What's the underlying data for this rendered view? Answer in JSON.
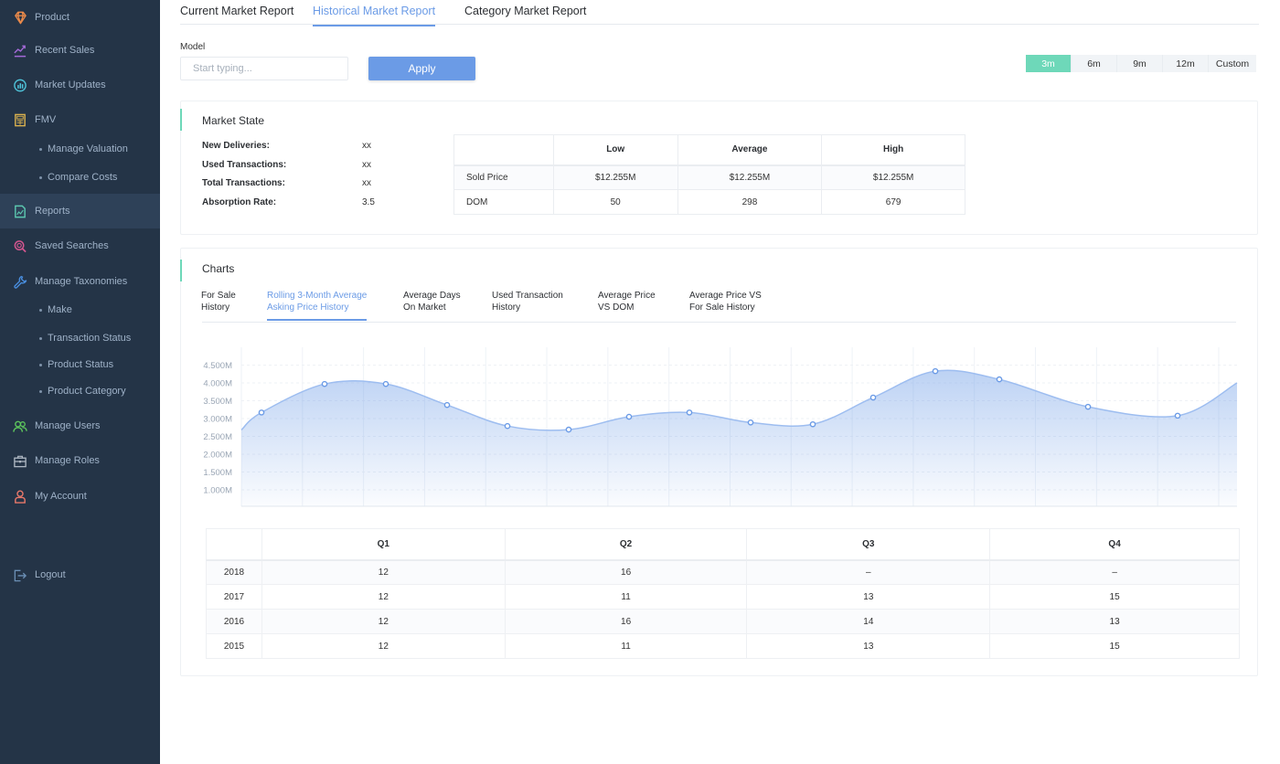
{
  "sidebar": {
    "items": [
      {
        "label": "Product",
        "icon": "diamond-icon",
        "color": "#e8894a"
      },
      {
        "label": "Recent Sales",
        "icon": "trend-up-icon",
        "color": "#a46ad8"
      },
      {
        "label": "Market Updates",
        "icon": "chart-refresh-icon",
        "color": "#4fc3d9"
      },
      {
        "label": "FMV",
        "icon": "calculator-icon",
        "color": "#d9b14f"
      },
      {
        "label": "Reports",
        "icon": "report-icon",
        "color": "#5cc8b0"
      },
      {
        "label": "Saved Searches",
        "icon": "search-icon",
        "color": "#d4568f"
      },
      {
        "label": "Manage Taxonomies",
        "icon": "wrench-icon",
        "color": "#4a90e2"
      },
      {
        "label": "Manage Users",
        "icon": "users-icon",
        "color": "#5cc35c"
      },
      {
        "label": "Manage Roles",
        "icon": "briefcase-icon",
        "color": "#b0b9c4"
      },
      {
        "label": "My Account",
        "icon": "user-icon",
        "color": "#e8786a"
      },
      {
        "label": "Logout",
        "icon": "logout-icon",
        "color": "#6b8fb5"
      }
    ],
    "fmv_sub": [
      "Manage Valuation",
      "Compare Costs"
    ],
    "taxonomy_sub": [
      "Make",
      "Transaction Status",
      "Product Status",
      "Product Category"
    ],
    "active": "Reports"
  },
  "top_tabs": [
    {
      "label": "Current Market Report",
      "active": false
    },
    {
      "label": "Historical Market Report",
      "active": true
    },
    {
      "label": "Category Market Report",
      "active": false
    }
  ],
  "filter": {
    "model_label": "Model",
    "model_placeholder": "Start typing...",
    "model_value": "",
    "apply_label": "Apply"
  },
  "periods": [
    {
      "label": "3m",
      "active": true
    },
    {
      "label": "6m",
      "active": false
    },
    {
      "label": "9m",
      "active": false
    },
    {
      "label": "12m",
      "active": false
    },
    {
      "label": "Custom",
      "active": false
    }
  ],
  "market_state": {
    "title": "Market State",
    "rows": [
      {
        "label": "New Deliveries:",
        "value": "xx"
      },
      {
        "label": "Used Transactions:",
        "value": "xx"
      },
      {
        "label": "Total Transactions:",
        "value": "xx"
      },
      {
        "label": "Absorption Rate:",
        "value": "3.5"
      }
    ],
    "table": {
      "headers": [
        "",
        "Low",
        "Average",
        "High"
      ],
      "rows": [
        [
          "Sold Price",
          "$12.255M",
          "$12.255M",
          "$12.255M"
        ],
        [
          "DOM",
          "50",
          "298",
          "679"
        ]
      ]
    }
  },
  "charts": {
    "title": "Charts",
    "tabs": [
      {
        "label": "For Sale\nHistory",
        "active": false
      },
      {
        "label": "Rolling 3-Month Average\nAsking Price History",
        "active": true
      },
      {
        "label": "Average Days\nOn Market",
        "active": false
      },
      {
        "label": "Used Transaction\nHistory",
        "active": false
      },
      {
        "label": "Average Price\nVS DOM",
        "active": false
      },
      {
        "label": "Average Price VS\nFor Sale History",
        "active": false
      }
    ],
    "quarter_table": {
      "headers": [
        "",
        "Q1",
        "Q2",
        "Q3",
        "Q4"
      ],
      "rows": [
        [
          "2018",
          "12",
          "16",
          "–",
          "–"
        ],
        [
          "2017",
          "12",
          "11",
          "13",
          "15"
        ],
        [
          "2016",
          "12",
          "16",
          "14",
          "13"
        ],
        [
          "2015",
          "12",
          "11",
          "13",
          "15"
        ]
      ]
    }
  },
  "chart_data": {
    "type": "area",
    "title": "Rolling 3-Month Average Asking Price History",
    "xlabel": "",
    "ylabel": "",
    "y_ticks": [
      "1.000M",
      "1.500M",
      "2.000M",
      "2.500M",
      "3.000M",
      "3.500M",
      "4.000M",
      "4.500M"
    ],
    "ylim": [
      0.6,
      4.9
    ],
    "grid": true,
    "series": [
      {
        "name": "Rolling 3-Month Average Asking Price",
        "color": "#6b9be6",
        "values": [
          3.17,
          3.97,
          3.97,
          3.38,
          2.79,
          2.69,
          3.05,
          3.17,
          2.89,
          2.84,
          3.59,
          4.33,
          4.1,
          3.33,
          3.08
        ]
      }
    ]
  }
}
